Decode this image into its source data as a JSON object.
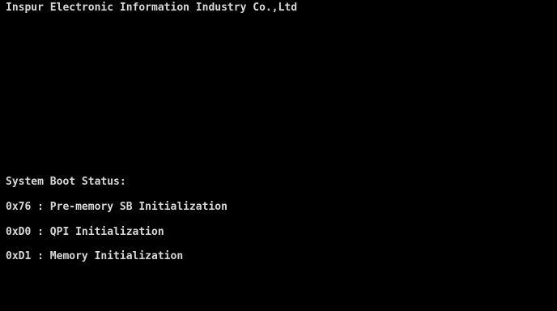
{
  "header": {
    "company": "Inspur Electronic Information Industry Co.,Ltd"
  },
  "boot_status": {
    "heading": "System Boot Status:",
    "entries": [
      {
        "code": "0xD1",
        "separator": " : ",
        "description": "Memory Initialization"
      }
    ],
    "lines": [
      "0x76 : Pre-memory SB Initialization",
      "0xD0 : QPI Initialization",
      "0xD1 : Memory Initialization"
    ]
  },
  "colors": {
    "background": "#000000",
    "text": "#d8d8d8"
  }
}
